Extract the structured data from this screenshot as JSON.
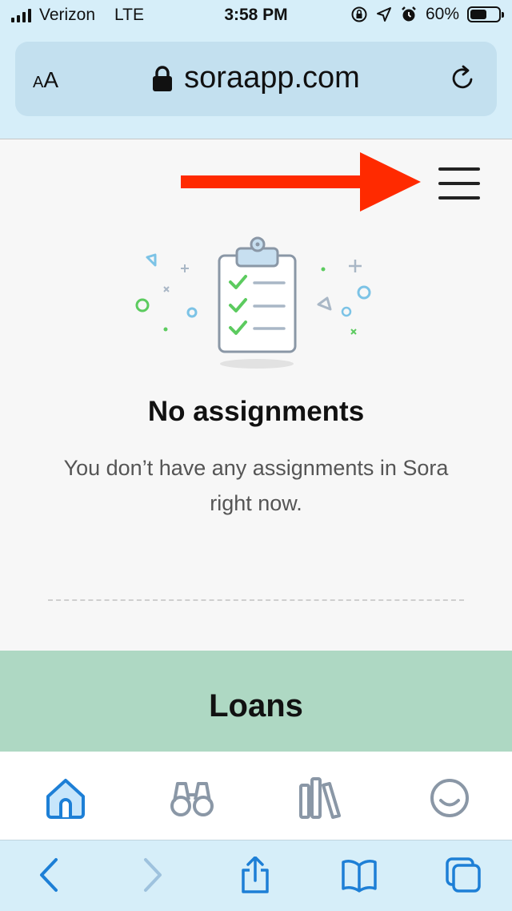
{
  "status_bar": {
    "carrier": "Verizon",
    "network": "LTE",
    "time": "3:58 PM",
    "battery_percent": "60%",
    "battery_level": 0.6,
    "icons": [
      "signal-icon",
      "orientation-lock-icon",
      "location-icon",
      "alarm-icon",
      "battery-icon"
    ]
  },
  "browser": {
    "text_size_label": "AA",
    "url": "soraapp.com",
    "icons": [
      "lock-icon",
      "reload-icon"
    ]
  },
  "page": {
    "annotation": "red-arrow",
    "menu_icon": "hamburger-menu-icon",
    "empty_state": {
      "title": "No assignments",
      "message": "You don’t have any assignments in Sora right now."
    },
    "section_title": "Loans"
  },
  "app_nav": {
    "items": [
      {
        "name": "home",
        "icon": "home-icon",
        "active": true
      },
      {
        "name": "explore",
        "icon": "binoculars-icon",
        "active": false
      },
      {
        "name": "library",
        "icon": "books-icon",
        "active": false
      },
      {
        "name": "profile",
        "icon": "smiley-icon",
        "active": false
      }
    ]
  },
  "safari_toolbar": {
    "items": [
      "back-icon",
      "forward-icon",
      "share-icon",
      "bookmarks-icon",
      "tabs-icon"
    ]
  },
  "colors": {
    "chrome_bg": "#d6eef9",
    "url_bar_bg": "#c3e0ef",
    "loans_bg": "#aed8c3",
    "accent_blue": "#1d7fd6",
    "arrow_red": "#ff2a00",
    "check_green": "#5ccb5f"
  }
}
